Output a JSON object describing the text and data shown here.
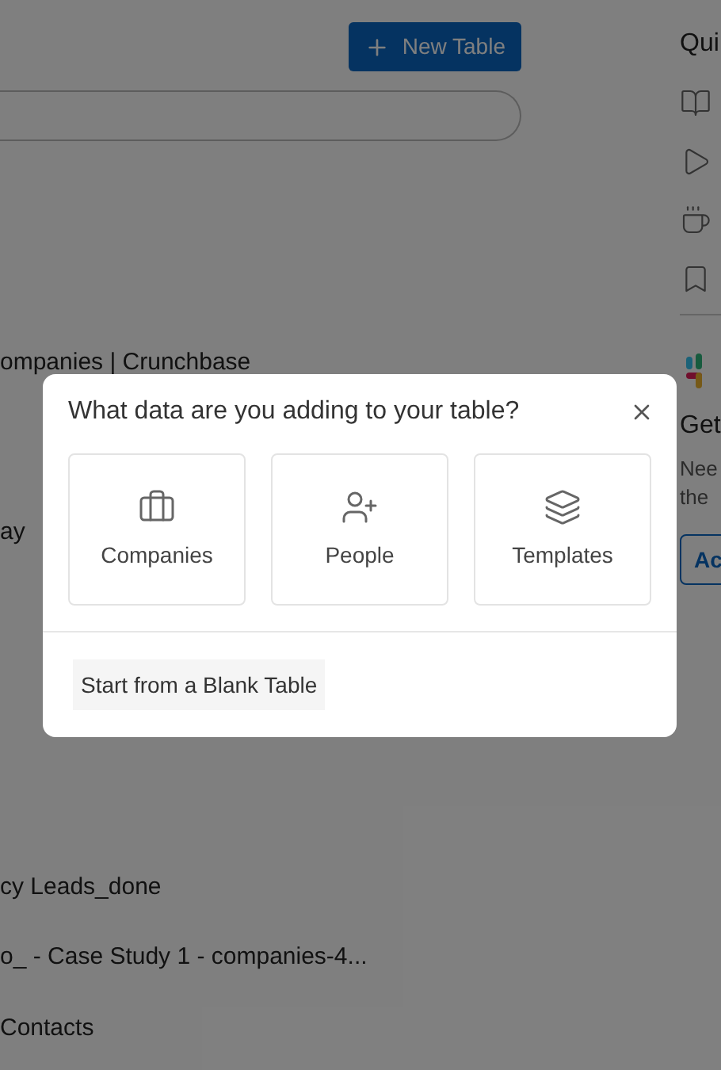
{
  "toolbar": {
    "new_table_button": "New Table"
  },
  "tables": [
    {
      "name": "ompanies | Crunchbase"
    },
    {
      "name": "ay"
    },
    {
      "name": "cy Leads_done"
    },
    {
      "name": "o_ - Case Study 1 - companies-4..."
    },
    {
      "name": "Contacts"
    }
  ],
  "side_panel": {
    "title": "Qui",
    "promo_title": "Get",
    "promo_text_lines": [
      "Nee",
      "the"
    ],
    "promo_button": "Ac"
  },
  "dialog": {
    "title": "What data are you adding to your table?",
    "options": [
      {
        "kind": "companies",
        "label": "Companies"
      },
      {
        "kind": "people",
        "label": "People"
      },
      {
        "kind": "templates",
        "label": "Templates"
      }
    ],
    "blank_button": "Start from a Blank Table"
  }
}
